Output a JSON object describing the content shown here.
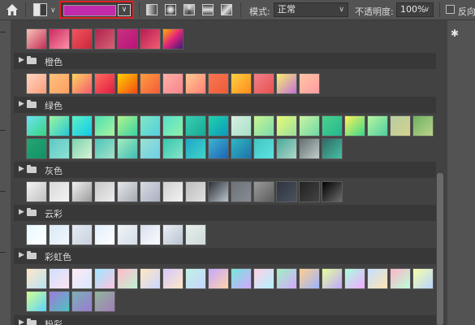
{
  "toolbar": {
    "home_icon": "home-icon",
    "mode_label": "模式:",
    "mode_value": "正常",
    "opacity_label": "不透明度:",
    "opacity_value": "100%",
    "reverse_label": "反向",
    "selected_gradient": [
      "#c12ab0",
      "#c32aa7"
    ]
  },
  "panel": {
    "settings_icon": "gear-icon",
    "groups": [
      {
        "name": "",
        "top": 0,
        "swatches": [
          [
            "#f7c4b8",
            "#c42b56"
          ],
          [
            "#c92c62",
            "#ff8fa6"
          ],
          [
            "#f2555e",
            "#c9263b"
          ],
          [
            "#b1224e",
            "#d56375"
          ],
          [
            "#c8307d",
            "#b8147a"
          ],
          [
            "#b81c52",
            "#f15d73"
          ],
          [
            "#ffb100",
            "#e0227b",
            "#3b1d7a"
          ]
        ]
      },
      {
        "name": "橙色",
        "swatches": [
          [
            "#ffd8c2",
            "#fb9b79"
          ],
          [
            "#ffc27c",
            "#fc9e62"
          ],
          [
            "#ffd360",
            "#f45b6e"
          ],
          [
            "#ff6d5e",
            "#e01a42"
          ],
          [
            "#ffd000",
            "#f24a16"
          ],
          [
            "#ff9c3f",
            "#f25c3a"
          ],
          [
            "#ffb1a8",
            "#f7838b"
          ],
          [
            "#ffca91",
            "#ff7f76"
          ],
          [
            "#f8764f",
            "#ef5b3c"
          ],
          [
            "#ffd140",
            "#ff8a1e"
          ],
          [
            "#f27f8a",
            "#e5534f"
          ],
          [
            "#f9f06b",
            "#c36fd8"
          ],
          [
            "#ffc6a5",
            "#ff9ca1"
          ]
        ]
      },
      {
        "name": "绿色",
        "rows": 2,
        "swatches": [
          [
            "#6ce1f5",
            "#37d57f"
          ],
          [
            "#9ff59f",
            "#25c6d5"
          ],
          [
            "#5cf2c6",
            "#10c9e8"
          ],
          [
            "#4ee0b2",
            "#a8f4a1"
          ],
          [
            "#b2f28b",
            "#3bd4a6"
          ],
          [
            "#7fe7c2",
            "#54cfde"
          ],
          [
            "#57e0c8",
            "#8ef0ad"
          ],
          [
            "#35cfb1",
            "#1aa996"
          ],
          [
            "#1fd3a8",
            "#0c98c1"
          ],
          [
            "#d6f0e1",
            "#a8e0c7"
          ],
          [
            "#c9f58f",
            "#7bdcaf"
          ],
          [
            "#e8fa74",
            "#9be0a0"
          ],
          [
            "#cbf5a2",
            "#6fd6a6"
          ],
          [
            "#4bd18d",
            "#23b88f"
          ],
          [
            "#fef259",
            "#39d88d"
          ],
          [
            "#b9f4a2",
            "#4ecf9e"
          ],
          [
            "#b7cda4",
            "#d3d28a"
          ],
          [
            "#6cb25f",
            "#bdd28c"
          ],
          [
            "#24a672",
            "#149167"
          ],
          [
            "#5fc8c3",
            "#8be2d6"
          ],
          [
            "#7ad2b0",
            "#d9f3d3"
          ],
          [
            "#4cc5b9",
            "#a4e2c8"
          ],
          [
            "#a4ecbf",
            "#41bdb3"
          ],
          [
            "#9be1d3",
            "#6dcfe5"
          ],
          [
            "#34c9ad",
            "#88e2c9"
          ],
          [
            "#1da7c8",
            "#43d3c8"
          ],
          [
            "#3db5cf",
            "#1d63b6"
          ],
          [
            "#2fb8c3",
            "#1f71a9"
          ],
          [
            "#41c6bf",
            "#5de2e4"
          ],
          [
            "#48a99a",
            "#afd7ca"
          ],
          [
            "#636f72",
            "#c1cdc9"
          ],
          [
            "#2f6a66",
            "#47c0a4"
          ]
        ]
      },
      {
        "name": "灰色",
        "swatches": [
          [
            "#f4f4f4",
            "#bfbfbf"
          ],
          [
            "#d9d9d9",
            "#f3f3f3"
          ],
          [
            "#f0f0f0",
            "#9c9c9c"
          ],
          [
            "#c8c8c8",
            "#ececec"
          ],
          [
            "#e4e7ea",
            "#a4aab2"
          ],
          [
            "#d7dbe4",
            "#a9b0bf"
          ],
          [
            "#d0d0d0",
            "#f2f2f2"
          ],
          [
            "#bdbdbd",
            "#e0e0e0"
          ],
          [
            "#2c3138",
            "#bbc3cc"
          ],
          [
            "#6d7278",
            "#878c92"
          ],
          [
            "#9a9a9a",
            "#5c5c5c"
          ],
          [
            "#2e3440",
            "#4a535e"
          ],
          [
            "#232323",
            "#434343"
          ],
          [
            "#000000",
            "#6d6d6d"
          ]
        ]
      },
      {
        "name": "云彩",
        "swatches": [
          [
            "#e8faff",
            "#ffffff"
          ],
          [
            "#d8e9f6",
            "#f3f8ff"
          ],
          [
            "#e4eaf2",
            "#c9d2de"
          ],
          [
            "#e0eefb",
            "#ffffff"
          ],
          [
            "#f1f4f7",
            "#d4dde7"
          ],
          [
            "#d7dfee",
            "#fbfcff"
          ],
          [
            "#e9eef3",
            "#b9c4d1"
          ],
          [
            "#e7efec",
            "#ced9d8"
          ]
        ]
      },
      {
        "name": "彩虹色",
        "rows": 2,
        "swatches": [
          [
            "#ffe8c7",
            "#b8e2f5"
          ],
          [
            "#cfe0ff",
            "#ffe2f0"
          ],
          [
            "#ffeaf3",
            "#d7e8ff"
          ],
          [
            "#9ee7ff",
            "#ffc4e0"
          ],
          [
            "#ffbacb",
            "#c0f3d4"
          ],
          [
            "#ffe6c2",
            "#ccd7ff"
          ],
          [
            "#d6c8ff",
            "#ffe7c3"
          ],
          [
            "#bff3e1",
            "#c7d2ff"
          ],
          [
            "#c6a6ff",
            "#ffd4a8"
          ],
          [
            "#76e6d8",
            "#d4a8ff"
          ],
          [
            "#ffd0e6",
            "#b3f1ff"
          ],
          [
            "#a0f0c0",
            "#d4a8ff"
          ],
          [
            "#ffcf8e",
            "#9db4ff"
          ],
          [
            "#e4ff9c",
            "#bfa8ff"
          ],
          [
            "#a8ffdc",
            "#f5a8ff"
          ],
          [
            "#c5e0ff",
            "#ffe4b0"
          ],
          [
            "#ffb5c9",
            "#b8ffd8"
          ],
          [
            "#f5ffa8",
            "#b8d4ff"
          ],
          [
            "#d5ff8f",
            "#5ad2ff"
          ],
          [
            "#9d7bd6",
            "#4ec3c1"
          ],
          [
            "#7ab1b3",
            "#9b7bd3"
          ],
          [
            "#90b59b",
            "#a27db9"
          ]
        ]
      },
      {
        "name": "粉彩",
        "swatches": []
      }
    ]
  }
}
